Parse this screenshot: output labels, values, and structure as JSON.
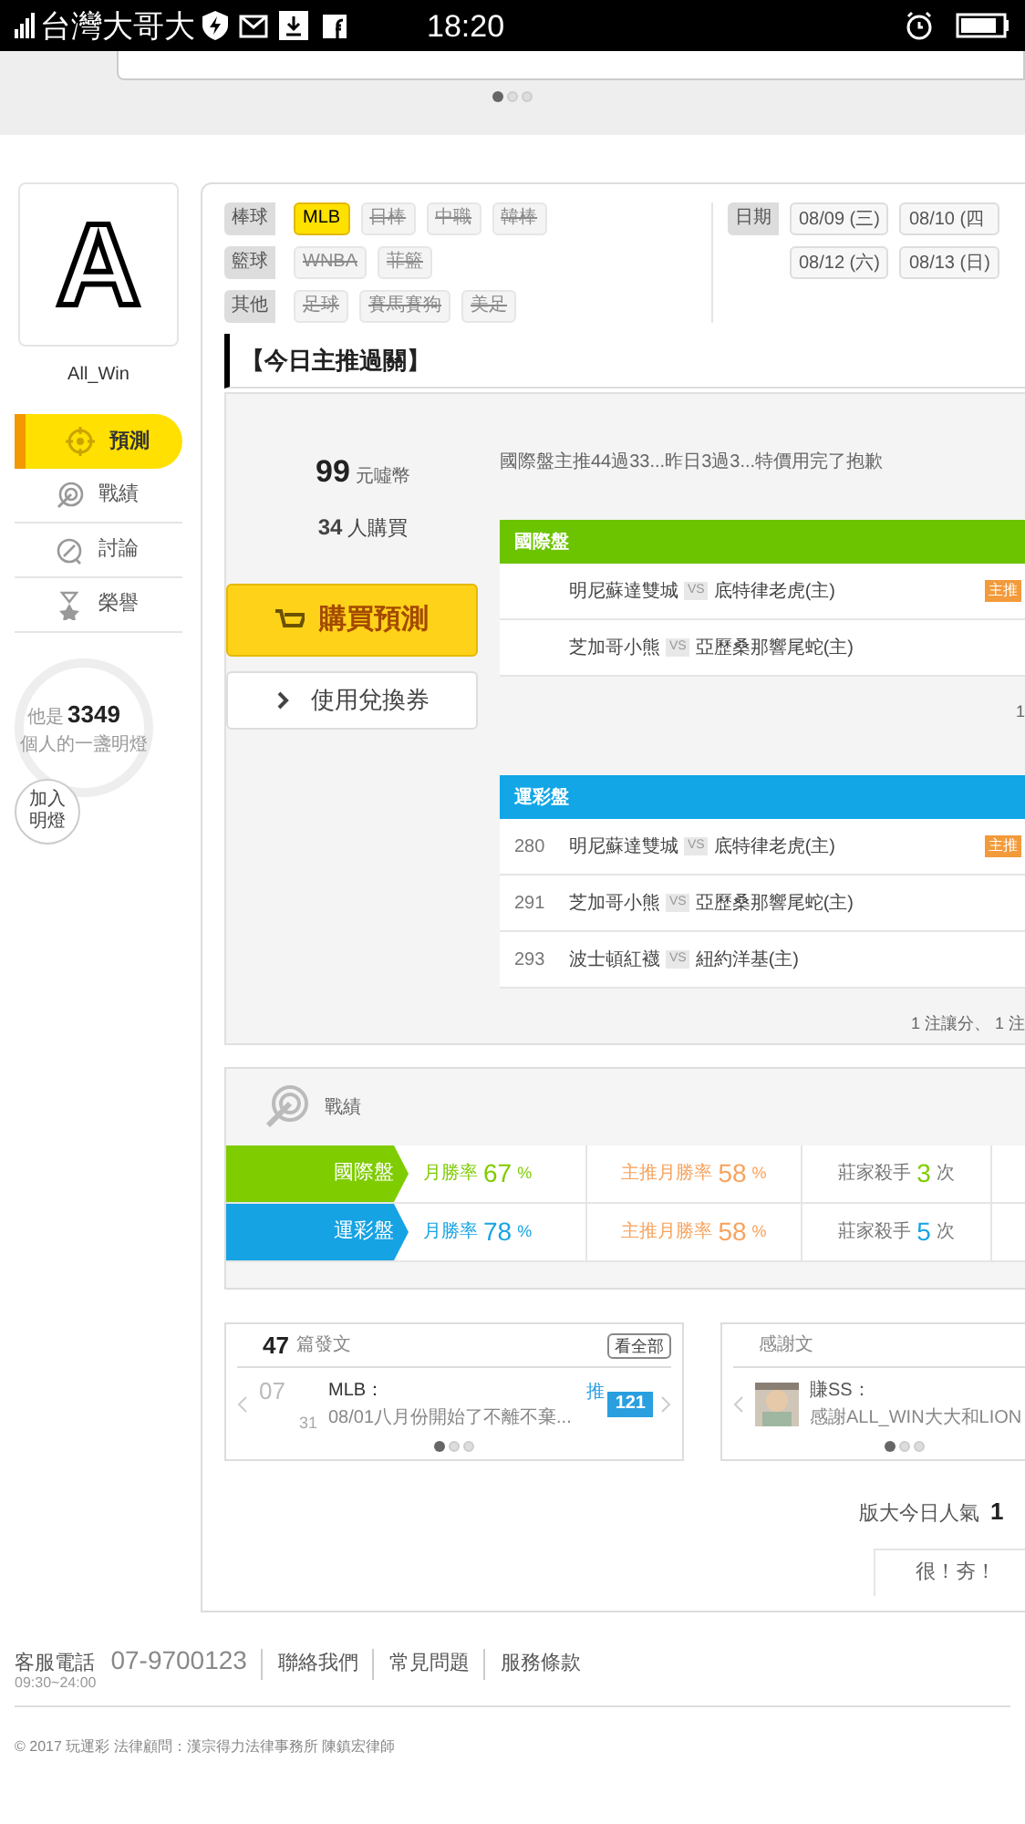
{
  "status_bar": {
    "carrier": "台灣大哥大",
    "time": "18:20"
  },
  "carousel": {
    "dots": [
      {
        "selected": true
      },
      {
        "selected": false
      },
      {
        "selected": false
      }
    ]
  },
  "profile": {
    "avatar_letter": "A",
    "name": "All_Win"
  },
  "nav": [
    {
      "label": "預測",
      "selected": true
    },
    {
      "label": "戰績",
      "selected": false
    },
    {
      "label": "討論",
      "selected": false
    },
    {
      "label": "榮譽",
      "selected": false
    }
  ],
  "lamp": {
    "prefix": "他是",
    "count": "3349",
    "suffix": "個人的一盞明燈",
    "button": "加入明燈"
  },
  "filters": [
    {
      "label": "棒球",
      "tags": [
        {
          "text": "MLB",
          "selected": true,
          "disabled": false
        },
        {
          "text": "日棒",
          "selected": false,
          "disabled": true
        },
        {
          "text": "中職",
          "selected": false,
          "disabled": true
        },
        {
          "text": "韓棒",
          "selected": false,
          "disabled": true
        }
      ]
    },
    {
      "label": "籃球",
      "tags": [
        {
          "text": "WNBA",
          "selected": false,
          "disabled": true
        },
        {
          "text": "菲籃",
          "selected": false,
          "disabled": true
        }
      ]
    },
    {
      "label": "其他",
      "tags": [
        {
          "text": "足球",
          "selected": false,
          "disabled": true
        },
        {
          "text": "賽馬賽狗",
          "selected": false,
          "disabled": true
        },
        {
          "text": "美足",
          "selected": false,
          "disabled": true
        }
      ]
    }
  ],
  "dates": {
    "label": "日期",
    "items": [
      "08/09 (三)",
      "08/10 (四",
      "08/12 (六)",
      "08/13 (日)"
    ]
  },
  "section_title": "【今日主推過關】",
  "price": {
    "amount": "99",
    "unit": "元噓幣",
    "buyers": "34",
    "buyers_unit": "人購買"
  },
  "buy_button": "購買預測",
  "coupon_button": "使用兌換券",
  "note": "國際盤主推44過33...昨日3過3...特價用完了抱歉",
  "tables": [
    {
      "title": "國際盤",
      "color": "#6cc400",
      "rows": [
        {
          "number": "",
          "away": "明尼蘇達雙城",
          "vs": "VS",
          "home": "底特律老虎(主)",
          "badge": "主推"
        },
        {
          "number": "",
          "away": "芝加哥小熊",
          "vs": "VS",
          "home": "亞歷桑那響尾蛇(主)",
          "badge": ""
        }
      ],
      "footer": "1"
    },
    {
      "title": "運彩盤",
      "color": "#12a6e6",
      "rows": [
        {
          "number": "280",
          "away": "明尼蘇達雙城",
          "vs": "VS",
          "home": "底特律老虎(主)",
          "badge": "主推"
        },
        {
          "number": "291",
          "away": "芝加哥小熊",
          "vs": "VS",
          "home": "亞歷桑那響尾蛇(主)",
          "badge": ""
        },
        {
          "number": "293",
          "away": "波士頓紅襪",
          "vs": "VS",
          "home": "紐約洋基(主)",
          "badge": ""
        }
      ],
      "footer": "1 注讓分、 1 注"
    }
  ],
  "record": {
    "title": "戰績",
    "rows": [
      {
        "label": "國際盤",
        "color": "#7fcc00",
        "win_label": "月勝率",
        "win": "67",
        "main_label": "主推月勝率",
        "main": "58",
        "killer_label": "莊家殺手",
        "killer": "3",
        "unit": "次",
        "percent": "%"
      },
      {
        "label": "運彩盤",
        "color": "#16a3e3",
        "win_label": "月勝率",
        "win": "78",
        "main_label": "主推月勝率",
        "main": "58",
        "killer_label": "莊家殺手",
        "killer": "5",
        "unit": "次",
        "percent": "%"
      }
    ]
  },
  "posts": {
    "count": "47",
    "label": "篇發文",
    "button": "看全部",
    "month": "07",
    "day": "31",
    "title": "MLB：",
    "text": "08/01八月份開始了不離不棄...",
    "push": "推",
    "push_count": "121",
    "dots": [
      {
        "selected": true
      },
      {
        "selected": false
      },
      {
        "selected": false
      }
    ]
  },
  "thanks": {
    "title": "感謝文",
    "name": "賺SS：",
    "text": "感謝ALL_WIN大大和LION",
    "dots": [
      {
        "selected": true
      },
      {
        "selected": false
      },
      {
        "selected": false
      }
    ]
  },
  "popularity": {
    "label": "版大今日人氣",
    "value": "1"
  },
  "hot_button": "很！夯！",
  "footer": {
    "phone_label": "客服電話",
    "hours": "09:30~24:00",
    "phone": "07-9700123",
    "links": [
      "聯絡我們",
      "常見問題",
      "服務條款"
    ],
    "copyright": "© 2017 玩運彩 法律顧問：漢宗得力法律事務所 陳鎮宏律師"
  }
}
